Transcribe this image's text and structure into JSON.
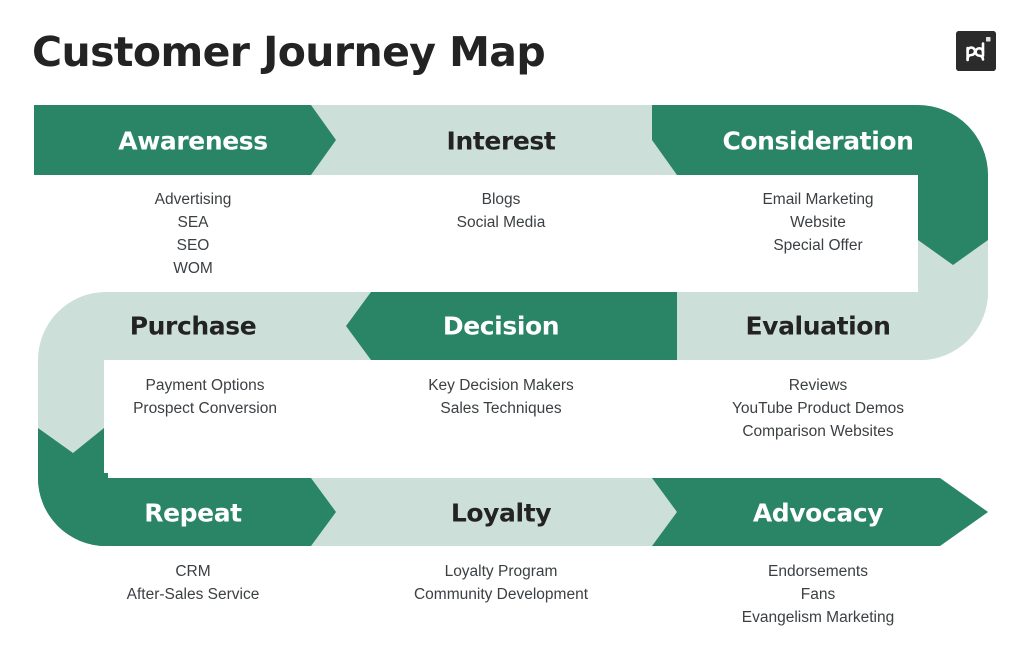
{
  "header": {
    "title": "Customer Journey Map",
    "logo_alt": "pandadoc-logo"
  },
  "colors": {
    "dark_green": "#2a8567",
    "light_green": "#ccdfd8",
    "white": "#ffffff",
    "title_text": "#232323",
    "body_text": "#3c4043",
    "logo_bg": "#2b2b2b"
  },
  "rows": [
    {
      "direction": "left-to-right"
    },
    {
      "direction": "right-to-left"
    },
    {
      "direction": "left-to-right"
    }
  ],
  "stages": [
    {
      "id": "awareness",
      "label": "Awareness",
      "row": 1,
      "column": 1,
      "fill": "dark",
      "items": [
        "Advertising",
        "SEA",
        "SEO",
        "WOM"
      ]
    },
    {
      "id": "interest",
      "label": "Interest",
      "row": 1,
      "column": 2,
      "fill": "light",
      "items": [
        "Blogs",
        "Social Media"
      ]
    },
    {
      "id": "consideration",
      "label": "Consideration",
      "row": 1,
      "column": 3,
      "fill": "dark",
      "items": [
        "Email Marketing",
        "Website",
        "Special Offer"
      ]
    },
    {
      "id": "purchase",
      "label": "Purchase",
      "row": 2,
      "column": 1,
      "fill": "light",
      "items": [
        "Payment Options",
        "Prospect Conversion"
      ]
    },
    {
      "id": "decision",
      "label": "Decision",
      "row": 2,
      "column": 2,
      "fill": "dark",
      "items": [
        "Key Decision Makers",
        "Sales Techniques"
      ]
    },
    {
      "id": "evaluation",
      "label": "Evaluation",
      "row": 2,
      "column": 3,
      "fill": "light",
      "items": [
        "Reviews",
        "YouTube Product Demos",
        "Comparison Websites"
      ]
    },
    {
      "id": "repeat",
      "label": "Repeat",
      "row": 3,
      "column": 1,
      "fill": "dark",
      "items": [
        "CRM",
        "After-Sales Service"
      ]
    },
    {
      "id": "loyalty",
      "label": "Loyalty",
      "row": 3,
      "column": 2,
      "fill": "light",
      "items": [
        "Loyalty Program",
        "Community Development"
      ]
    },
    {
      "id": "advocacy",
      "label": "Advocacy",
      "row": 3,
      "column": 3,
      "fill": "dark",
      "items": [
        "Endorsements",
        "Fans",
        "Evangelism Marketing"
      ]
    }
  ]
}
